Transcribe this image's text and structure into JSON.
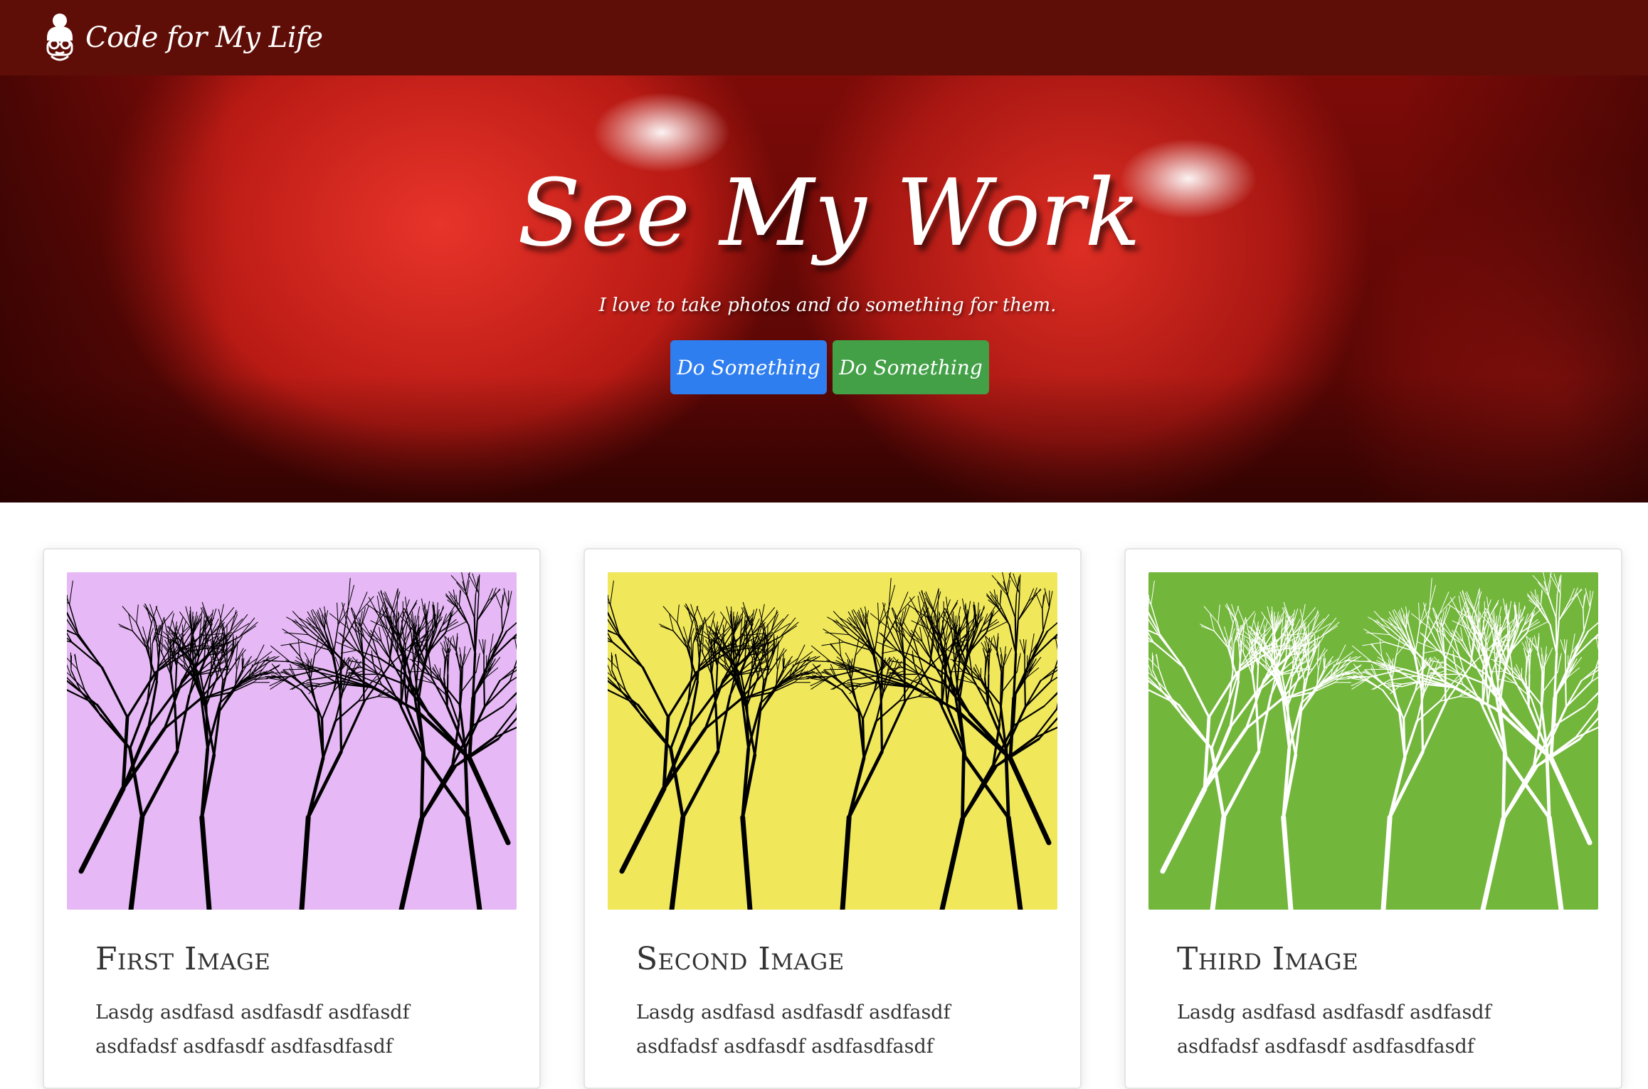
{
  "navbar": {
    "brand_text": "Code for My Life",
    "logo_icon": "girl-with-glasses-icon",
    "background": "#5e0e07"
  },
  "hero": {
    "title": "See My Work",
    "subtitle": "I love to take photos and do something for them.",
    "buttons": [
      {
        "label": "Do Something",
        "color": "#2f7ef0"
      },
      {
        "label": "Do Something",
        "color": "#43a047"
      }
    ]
  },
  "cards": [
    {
      "title": "First Image",
      "text": "Lasdg asdfasd asdfasdf asdfasdf asdfadsf asdfasdf asdfasdfasdf",
      "image_bg": "#e6b8f5",
      "branch_color": "#000000"
    },
    {
      "title": "Second Image",
      "text": "Lasdg asdfasd asdfasdf asdfasdf asdfadsf asdfasdf asdfasdfasdf",
      "image_bg": "#f0e85a",
      "branch_color": "#000000"
    },
    {
      "title": "Third Image",
      "text": "Lasdg asdfasd asdfasdf asdfasdf asdfadsf asdfasdf asdfasdfasdf",
      "image_bg": "#72b63b",
      "branch_color": "#ffffff"
    }
  ]
}
